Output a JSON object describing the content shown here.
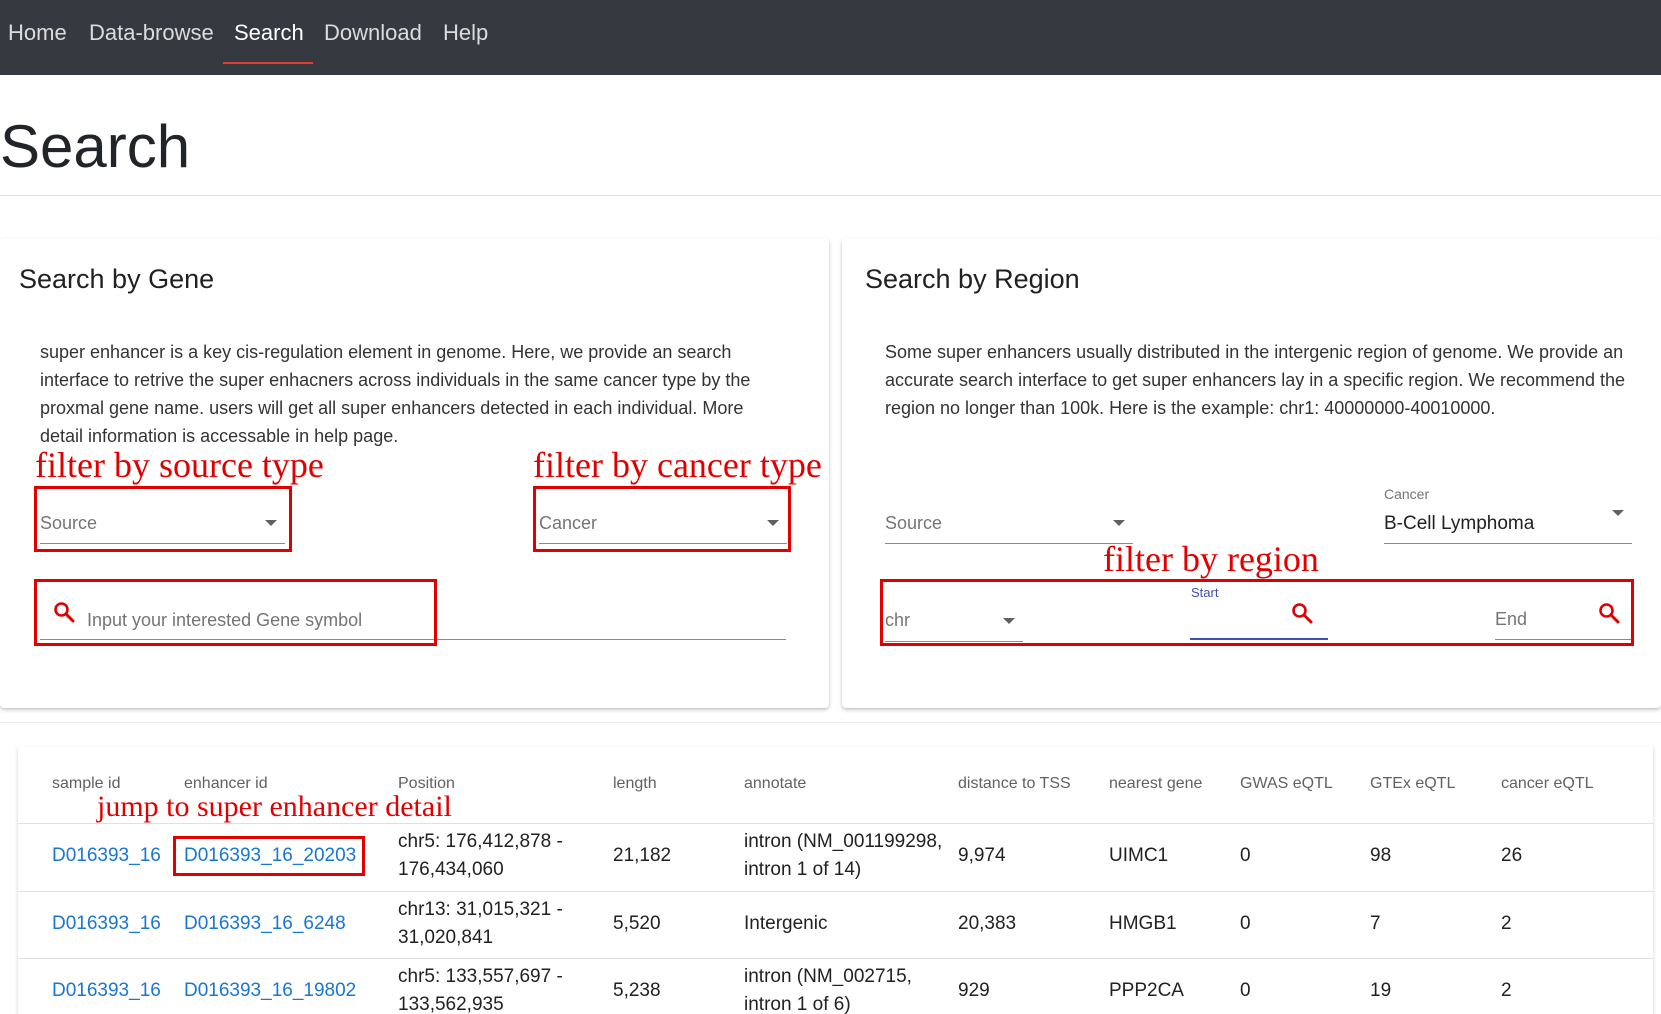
{
  "nav": {
    "items": [
      "Home",
      "Data-browse",
      "Search",
      "Download",
      "Help"
    ],
    "active": "Search"
  },
  "page": {
    "title": "Search"
  },
  "gene_card": {
    "title": "Search by Gene",
    "description": "super enhancer is a key cis-regulation element in genome. Here, we provide an search interface to retrive the super enhacners across individuals in the same cancer type by the proxmal gene name. users will get all super enhancers detected in each individual. More detail information is accessable in help page.",
    "source_label": "Source",
    "cancer_label": "Cancer",
    "gene_placeholder": "Input your interested Gene symbol"
  },
  "region_card": {
    "title": "Search by Region",
    "description": "Some super enhancers usually distributed in the intergenic region of genome. We provide an accurate search interface to get super enhancers lay in a specific region. We recommend the region no longer than 100k. Here is the example: chr1: 40000000-40010000.",
    "source_label": "Source",
    "cancer_label": "Cancer",
    "cancer_value": "B-Cell Lymphoma",
    "chr_label": "chr",
    "start_label": "Start",
    "end_label": "End"
  },
  "annotations": {
    "source": "filter by source type",
    "cancer": "filter by cancer type",
    "region": "filter by region",
    "enhancer": "jump to super enhancer detail"
  },
  "table": {
    "headers": [
      "sample id",
      "enhancer id",
      "Position",
      "length",
      "annotate",
      "distance to TSS",
      "nearest gene",
      "GWAS eQTL",
      "GTEx eQTL",
      "cancer eQTL"
    ],
    "rows": [
      {
        "sample_id": "D016393_16",
        "enhancer_id": "D016393_16_20203",
        "position_1": "chr5: 176,412,878 -",
        "position_2": "176,434,060",
        "length": "21,182",
        "annotate_1": "intron (NM_001199298,",
        "annotate_2": "intron 1 of 14)",
        "distance": "9,974",
        "gene": "UIMC1",
        "gwas": "0",
        "gtex": "98",
        "cancer": "26"
      },
      {
        "sample_id": "D016393_16",
        "enhancer_id": "D016393_16_6248",
        "position_1": "chr13: 31,015,321 -",
        "position_2": "31,020,841",
        "length": "5,520",
        "annotate_1": "Intergenic",
        "annotate_2": "",
        "distance": "20,383",
        "gene": "HMGB1",
        "gwas": "0",
        "gtex": "7",
        "cancer": "2"
      },
      {
        "sample_id": "D016393_16",
        "enhancer_id": "D016393_16_19802",
        "position_1": "chr5: 133,557,697 -",
        "position_2": "133,562,935",
        "length": "5,238",
        "annotate_1": "intron (NM_002715,",
        "annotate_2": "intron 1 of 6)",
        "distance": "929",
        "gene": "PPP2CA",
        "gwas": "0",
        "gtex": "19",
        "cancer": "2"
      }
    ]
  },
  "colors": {
    "topbar": "#343a40",
    "accent_underline": "#e53935",
    "link": "#1976d2",
    "annotation": "#e00000",
    "start_focus": "#3f51b5"
  }
}
